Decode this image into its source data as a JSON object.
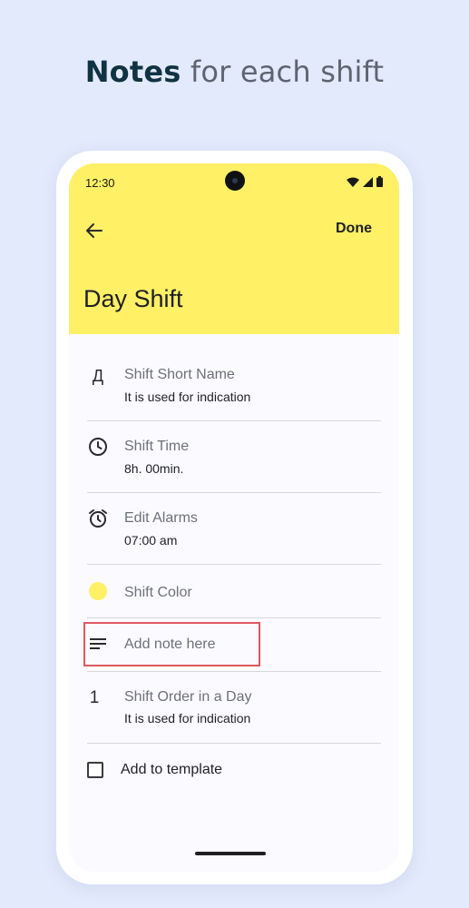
{
  "headline": {
    "strong": "Notes",
    "rest": " for each shift"
  },
  "status_bar": {
    "time": "12:30"
  },
  "app_bar": {
    "done_label": "Done",
    "title": "Day Shift"
  },
  "rows": [
    {
      "icon": "letter-icon",
      "glyph": "Д",
      "title": "Shift Short Name",
      "subtitle": "It is used for indication"
    },
    {
      "icon": "clock-icon",
      "title": "Shift Time",
      "subtitle": "8h. 00min."
    },
    {
      "icon": "alarm-icon",
      "title": "Edit Alarms",
      "subtitle": "07:00 am"
    },
    {
      "icon": "color-dot-icon",
      "title": "Shift Color"
    },
    {
      "icon": "notes-icon",
      "title": "Add note here"
    },
    {
      "icon": "number-icon",
      "glyph": "1",
      "title": "Shift Order in a Day",
      "subtitle": "It is used for indication"
    },
    {
      "icon": "checkbox-icon",
      "title": "Add to template"
    }
  ],
  "colors": {
    "accent_yellow": "#fff066",
    "highlight": "#e0575f",
    "background": "#e3eafc"
  }
}
